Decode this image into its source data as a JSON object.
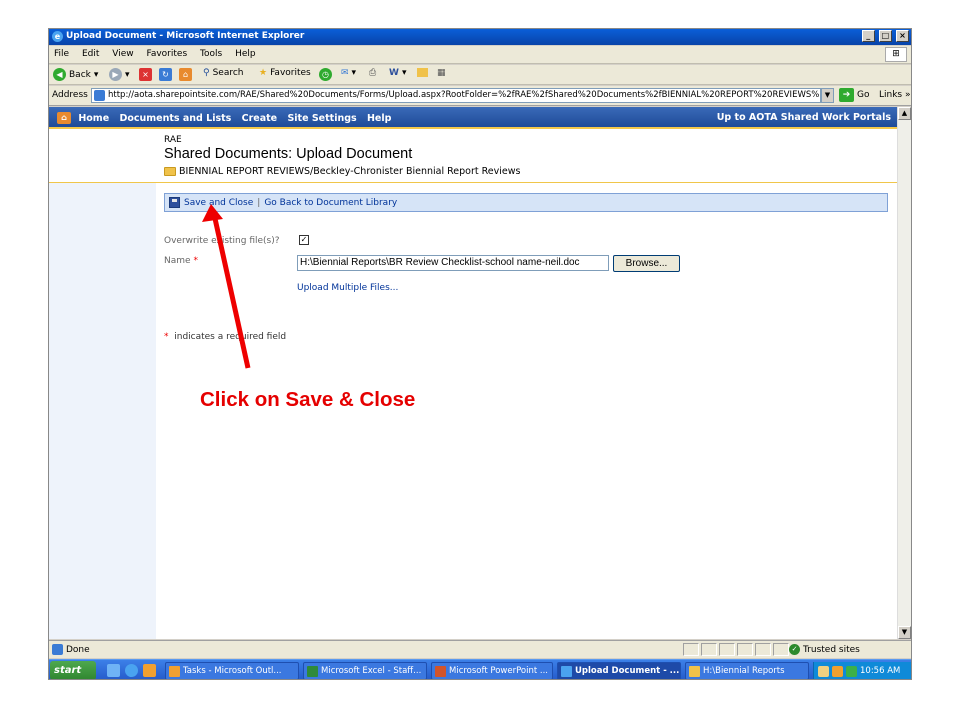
{
  "window": {
    "title": "Upload Document - Microsoft Internet Explorer",
    "buttons": [
      "_",
      "□",
      "×"
    ]
  },
  "menu": [
    "File",
    "Edit",
    "View",
    "Favorites",
    "Tools",
    "Help"
  ],
  "toolbar": {
    "back": "Back",
    "search": "Search",
    "favorites": "Favorites"
  },
  "address": {
    "label": "Address",
    "url": "http://aota.sharepointsite.com/RAE/Shared%20Documents/Forms/Upload.aspx?RootFolder=%2fRAE%2fShared%20Documents%2fBIENNIAL%20REPORT%20REVIEWS%",
    "go": "Go",
    "links": "Links"
  },
  "sp_nav": {
    "items": [
      "Home",
      "Documents and Lists",
      "Create",
      "Site Settings",
      "Help"
    ],
    "right_link": "Up to AOTA Shared Work Portals"
  },
  "header": {
    "site": "RAE",
    "title": "Shared Documents: Upload Document",
    "breadcrumb": "BIENNIAL REPORT REVIEWS/Beckley-Chronister Biennial Report Reviews"
  },
  "actions": {
    "save_close": "Save and Close",
    "separator": "|",
    "go_back": "Go Back to Document Library"
  },
  "form": {
    "overwrite_label": "Overwrite existing file(s)?",
    "overwrite_checked": true,
    "check_mark": "✓",
    "name_label": "Name",
    "required_mark": "*",
    "name_value": "H:\\Biennial Reports\\BR Review Checklist-school name-neil.doc",
    "browse": "Browse...",
    "upload_multiple": "Upload Multiple Files...",
    "required_note": "indicates a required field"
  },
  "callout": "Click on Save & Close",
  "status": {
    "text": "Done",
    "zone": "Trusted sites"
  },
  "taskbar": {
    "start": "start",
    "tasks": [
      "Tasks - Microsoft Outl...",
      "Microsoft Excel - Staff...",
      "Microsoft PowerPoint ...",
      "Upload Document - ...",
      "H:\\Biennial Reports"
    ],
    "clock": "10:56 AM"
  }
}
